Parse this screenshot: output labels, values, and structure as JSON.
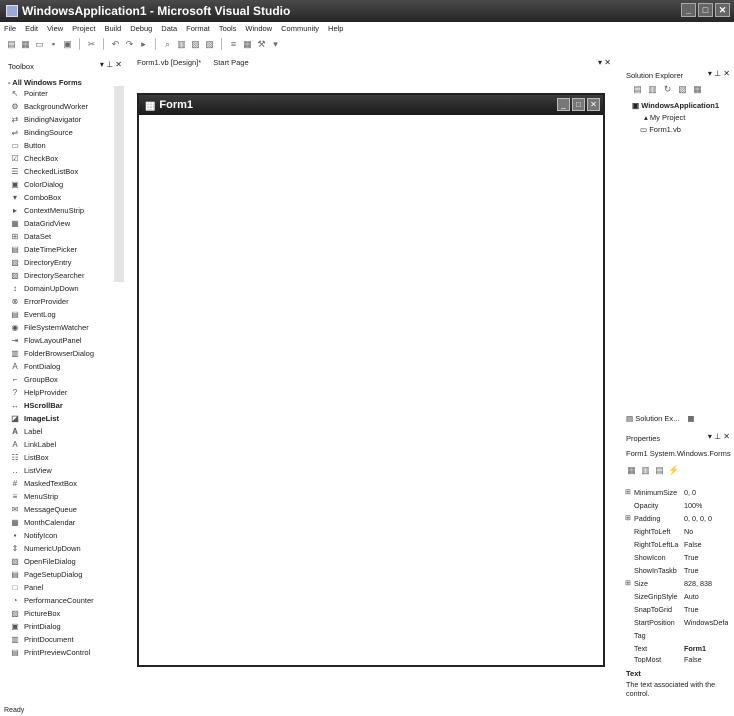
{
  "window": {
    "title": "WindowsApplication1 - Microsoft Visual Studio"
  },
  "menu": [
    "File",
    "Edit",
    "View",
    "Project",
    "Build",
    "Debug",
    "Data",
    "Format",
    "Tools",
    "Window",
    "Community",
    "Help"
  ],
  "toolbox": {
    "title": "Toolbox",
    "group": "- All Windows Forms",
    "items": [
      "Pointer",
      "BackgroundWorker",
      "BindingNavigator",
      "BindingSource",
      "Button",
      "CheckBox",
      "CheckedListBox",
      "ColorDialog",
      "ComboBox",
      "ContextMenuStrip",
      "DataGridView",
      "DataSet",
      "DateTimePicker",
      "DirectoryEntry",
      "DirectorySearcher",
      "DomainUpDown",
      "ErrorProvider",
      "EventLog",
      "FileSystemWatcher",
      "FlowLayoutPanel",
      "FolderBrowserDialog",
      "FontDialog",
      "GroupBox",
      "HelpProvider",
      "HScrollBar",
      "ImageList",
      "Label",
      "LinkLabel",
      "ListBox",
      "ListView",
      "MaskedTextBox",
      "MenuStrip",
      "MessageQueue",
      "MonthCalendar",
      "NotifyIcon",
      "NumericUpDown",
      "OpenFileDialog",
      "PageSetupDialog",
      "Panel",
      "PerformanceCounter",
      "PictureBox",
      "PrintDialog",
      "PrintDocument",
      "PrintPreviewControl"
    ]
  },
  "tabs": [
    "Form1.vb [Design]*",
    "Start Page"
  ],
  "form": {
    "title": "Form1"
  },
  "solution_explorer": {
    "title": "Solution Explorer",
    "root": "WindowsApplication1",
    "children": [
      "My Project",
      "Form1.vb"
    ],
    "tab": "Solution Ex..."
  },
  "properties": {
    "title": "Properties",
    "object": "Form1 System.Windows.Forms",
    "rows": [
      {
        "name": "MinimumSize",
        "value": "0, 0",
        "category": true
      },
      {
        "name": "Opacity",
        "value": "100%",
        "category": false
      },
      {
        "name": "Padding",
        "value": "0, 0, 0, 0",
        "category": true
      },
      {
        "name": "RightToLeft",
        "value": "No",
        "category": false
      },
      {
        "name": "RightToLeftLa",
        "value": "False",
        "category": false
      },
      {
        "name": "ShowIcon",
        "value": "True",
        "category": false
      },
      {
        "name": "ShowInTaskb",
        "value": "True",
        "category": false
      },
      {
        "name": "Size",
        "value": "828, 838",
        "category": true
      },
      {
        "name": "SizeGripStyle",
        "value": "Auto",
        "category": false
      },
      {
        "name": "SnapToGrid",
        "value": "True",
        "category": false
      },
      {
        "name": "StartPosition",
        "value": "WindowsDefa",
        "category": false
      },
      {
        "name": "Tag",
        "value": "",
        "category": false
      },
      {
        "name": "Text",
        "value": "Form1",
        "category": false
      },
      {
        "name": "TopMost",
        "value": "False",
        "category": false
      }
    ],
    "desc_title": "Text",
    "desc": "The text associated with the control."
  },
  "status": "Ready"
}
